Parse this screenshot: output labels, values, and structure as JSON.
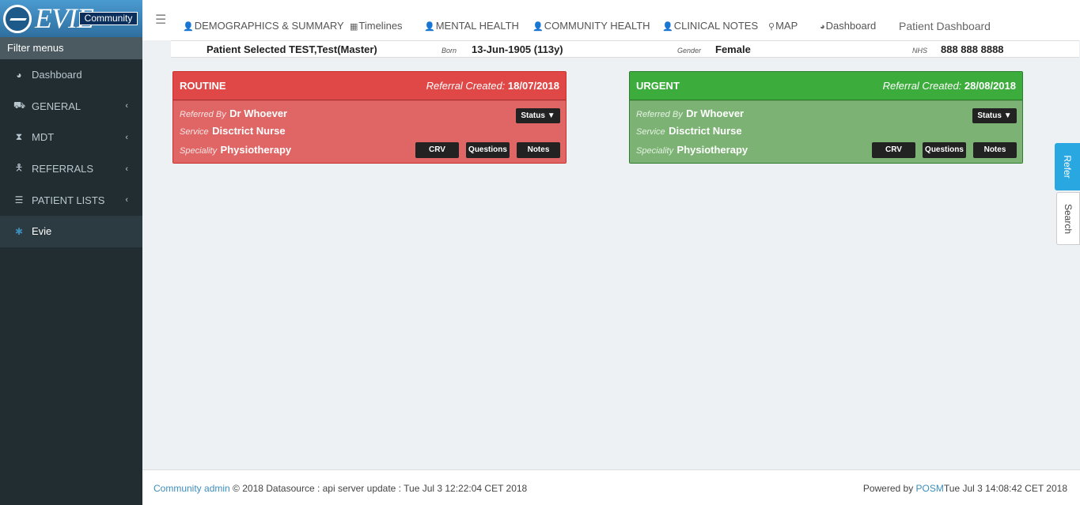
{
  "app": {
    "logo_text": "EVIE",
    "logo_badge": "Community"
  },
  "sidebar": {
    "title": "Filter menus",
    "items": [
      {
        "label": "Dashboard",
        "icon": "dashboard-icon",
        "has_chevron": false
      },
      {
        "label": "GENERAL",
        "icon": "car-icon",
        "has_chevron": true
      },
      {
        "label": "MDT",
        "icon": "hourglass-icon",
        "has_chevron": true
      },
      {
        "label": "REFERRALS",
        "icon": "user-icon",
        "has_chevron": true
      },
      {
        "label": "PATIENT LISTS",
        "icon": "list-icon",
        "has_chevron": true
      },
      {
        "label": "Evie",
        "icon": "asterisk-icon",
        "has_chevron": false,
        "active": true
      }
    ],
    "chevron": "‹"
  },
  "topnav": {
    "tabs": [
      {
        "label": "DEMOGRAPHICS & SUMMARY",
        "icon": "user-icon"
      },
      {
        "label": "Timelines",
        "icon": "calendar-icon"
      },
      {
        "label": "MENTAL HEALTH",
        "icon": "user-md-icon"
      },
      {
        "label": "COMMUNITY HEALTH",
        "icon": "user-md-icon"
      },
      {
        "label": "CLINICAL NOTES",
        "icon": "user-md-icon"
      },
      {
        "label": "MAP",
        "icon": "map-marker-icon"
      },
      {
        "label": "Dashboard",
        "icon": "dashboard-icon"
      }
    ],
    "page_title": "Patient Dashboard"
  },
  "patient": {
    "selected": "Patient Selected TEST,Test(Master)",
    "born_label": "Born",
    "born_value": "13-Jun-1905 (113y)",
    "gender_label": "Gender",
    "gender_value": "Female",
    "nhs_label": "NHS",
    "nhs_value": "888 888 8888"
  },
  "cards": [
    {
      "priority": "ROUTINE",
      "created_label": "Referral Created:",
      "created_date": "18/07/2018",
      "referred_by_label": "Referred By",
      "referred_by": "Dr Whoever",
      "service_label": "Service",
      "service": "Disctrict Nurse",
      "speciality_label": "Speciality",
      "speciality": "Physiotherapy",
      "status_button": "Status",
      "buttons": [
        "CRV",
        "Questions",
        "Notes"
      ],
      "color": "#e05858"
    },
    {
      "priority": "URGENT",
      "created_label": "Referral Created:",
      "created_date": "28/08/2018",
      "referred_by_label": "Referred By",
      "referred_by": "Dr Whoever",
      "service_label": "Service",
      "service": "Disctrict Nurse",
      "speciality_label": "Speciality",
      "speciality": "Physiotherapy",
      "status_button": "Status",
      "buttons": [
        "CRV",
        "Questions",
        "Notes"
      ],
      "color": "#3cac3c"
    }
  ],
  "side_tabs": {
    "refer": "Refer",
    "search": "Search"
  },
  "footer": {
    "admin_link": "Community admin",
    "left_text": "© 2018 Datasource : api server update : Tue Jul 3 12:22:04 CET 2018",
    "powered_by": "Powered by",
    "posm_link": "POSM",
    "right_text": "Tue Jul 3 14:08:42 CET 2018"
  }
}
